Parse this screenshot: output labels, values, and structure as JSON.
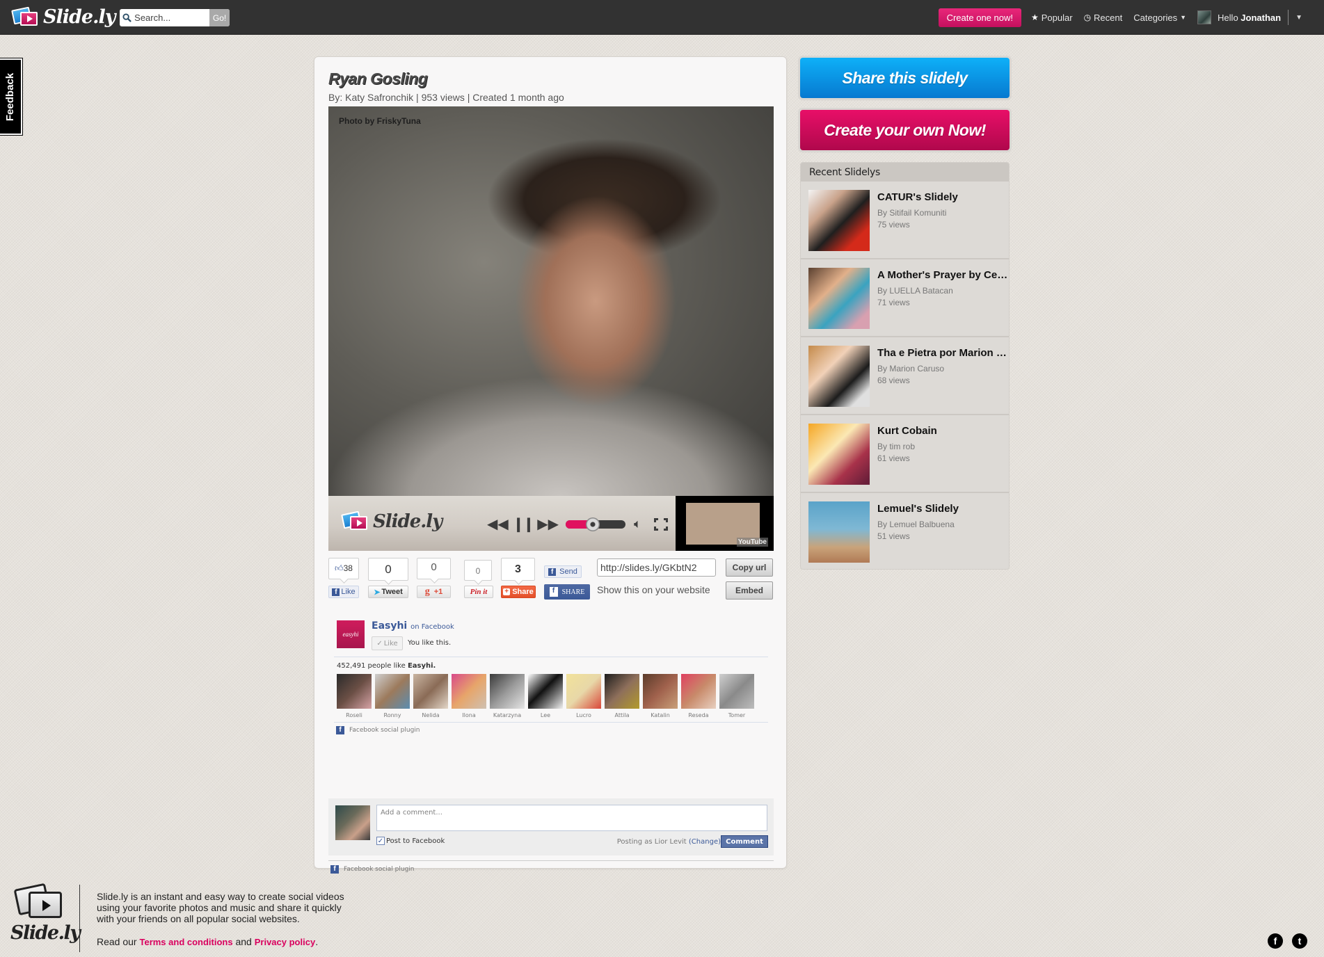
{
  "navbar": {
    "brand": "Slide.ly",
    "search_placeholder": "Search...",
    "search_go": "Go!",
    "create_button": "Create one now!",
    "links": [
      {
        "label": "Popular",
        "icon": "star-icon"
      },
      {
        "label": "Recent",
        "icon": "clock-icon"
      },
      {
        "label": "Categories",
        "icon": "chevron-down-icon"
      }
    ],
    "greeting": "Hello",
    "username": "Jonathan"
  },
  "feedback_tab": "Feedback",
  "slidely": {
    "title": "Ryan Gosling",
    "meta": "By: Katy Safronchik | 953 views | Created 1 month ago",
    "photo_credit": "Photo by FriskyTuna",
    "player": {
      "brand": "Slide.ly",
      "volume_percent": 45,
      "youtube_label": "YouTube"
    }
  },
  "share": {
    "fb_like_count": "38",
    "fb_like_label": "Like",
    "tweet_count": "0",
    "tweet_label": "Tweet",
    "gplus_count": "0",
    "gplus_label": "+1",
    "pin_count": "0",
    "pin_label": "Pin it",
    "share_count": "3",
    "share_label": "Share",
    "fb_send_label": "Send",
    "fb_share_label": "SHARE",
    "url_value": "http://slides.ly/GKbtN2",
    "copy_url_label": "Copy url",
    "show_on_site": "Show this on your website",
    "embed_label": "Embed"
  },
  "fb_likebox": {
    "page_name": "Easyhi",
    "on_facebook": "on Facebook",
    "liked_label": "Like",
    "you_like": "You like this.",
    "count_text": "452,491 people like",
    "count_page": "Easyhi.",
    "faces": [
      "Roseli",
      "Ronny",
      "Nelida",
      "Ilona",
      "Katarzyna",
      "Lee",
      "Lucro",
      "Attila",
      "Katalin",
      "Reseda",
      "Tomer"
    ],
    "plugin_label": "Facebook social plugin"
  },
  "fb_comments": {
    "placeholder": "Add a comment...",
    "post_to_fb": "Post to Facebook",
    "post_to_fb_checked": true,
    "posting_as": "Posting as Lior Levit",
    "change_label": "(Change)",
    "comment_button": "Comment",
    "plugin_label": "Facebook social plugin"
  },
  "sidebar": {
    "share_button": "Share this slidely",
    "create_button": "Create your own Now!",
    "recent_header": "Recent Slidelys",
    "recent": [
      {
        "title": "CATUR's Slidely",
        "by": "By Sitifail Komuniti",
        "views": "75 views"
      },
      {
        "title": "A Mother's Prayer by Celine Dion",
        "by": "By LUELLA Batacan",
        "views": "71 views"
      },
      {
        "title": "Tha e Pietra por Marion Caruso",
        "by": "By Marion Caruso",
        "views": "68 views"
      },
      {
        "title": "Kurt Cobain",
        "by": "By tim rob",
        "views": "61 views"
      },
      {
        "title": "Lemuel's Slidely",
        "by": "By Lemuel Balbuena",
        "views": "51 views"
      }
    ]
  },
  "footer": {
    "brand": "Slide.ly",
    "description": "Slide.ly is an instant and easy way to create social videos using your favorite photos and music and share it quickly with your friends on all popular social websites.",
    "read_our": "Read our",
    "terms": "Terms and conditions",
    "and": "and",
    "privacy": "Privacy policy",
    "period": "."
  },
  "colors": {
    "brand_pink": "#d9005e",
    "brand_blue": "#0a90e0",
    "facebook_blue": "#3b5998",
    "navbar_bg": "#323232"
  }
}
